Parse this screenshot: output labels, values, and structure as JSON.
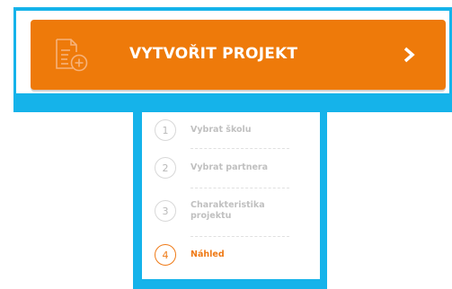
{
  "create_project": {
    "label": "VYTVOŘIT PROJEKT",
    "icon": "new-document-icon",
    "arrow_icon": "chevron-right-icon"
  },
  "steps": [
    {
      "number": "1",
      "label": "Vybrat školu",
      "active": false
    },
    {
      "number": "2",
      "label": "Vybrat partnera",
      "active": false
    },
    {
      "number": "3",
      "label": "Charakteristika projektu",
      "active": false
    },
    {
      "number": "4",
      "label": "Náhled",
      "active": true
    }
  ],
  "colors": {
    "accent": "#ee7a0a",
    "highlight_frame": "#15b3ea",
    "inactive_step": "#c0c0c0"
  }
}
